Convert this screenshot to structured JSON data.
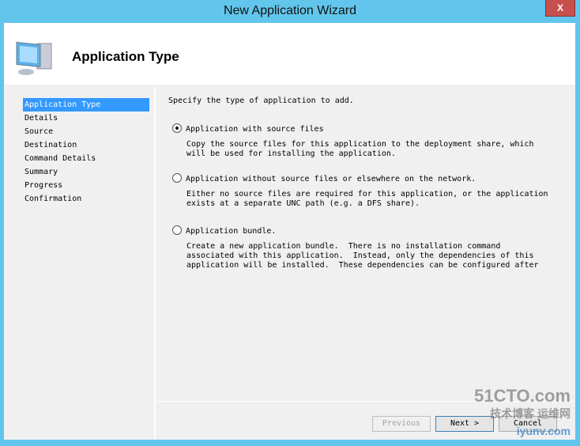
{
  "window": {
    "title": "New Application Wizard",
    "close_label": "X"
  },
  "header": {
    "title": "Application Type"
  },
  "nav": [
    "Application Type",
    "Details",
    "Source",
    "Destination",
    "Command Details",
    "Summary",
    "Progress",
    "Confirmation"
  ],
  "main": {
    "intro": "Specify the type of application to add.",
    "options": [
      {
        "label": "Application with source files",
        "selected": true,
        "desc": "Copy the source files for this application to the deployment share, which\nwill be used for installing the application."
      },
      {
        "label": "Application without source files or elsewhere on the network.",
        "selected": false,
        "desc": "Either no source files are required for this application, or the application\nexists at a separate UNC path (e.g. a DFS share)."
      },
      {
        "label": "Application bundle.",
        "selected": false,
        "desc": "Create a new application bundle.  There is no installation command\nassociated with this application.  Instead, only the dependencies of this\napplication will be installed.  These dependencies can be configured after"
      }
    ]
  },
  "buttons": {
    "previous": "Previous",
    "next": "Next >",
    "cancel": "Cancel"
  },
  "watermark": {
    "line1": "51CTO.com",
    "line2": "技术博客 运维网",
    "line3": "iyunv.com"
  }
}
